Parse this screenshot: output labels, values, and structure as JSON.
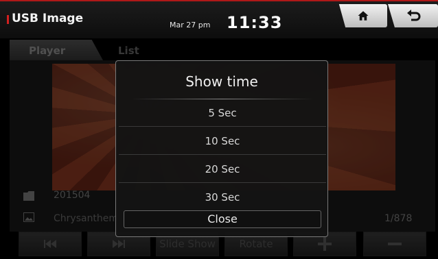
{
  "header": {
    "title": "USB Image",
    "date": "Mar 27 pm",
    "time": "11:33",
    "home_icon": "home-icon",
    "back_icon": "back-arrow-icon"
  },
  "tabs": [
    {
      "label": "Player"
    },
    {
      "label": "List"
    }
  ],
  "player": {
    "folder_name": "201504",
    "file_name": "Chrysanthem",
    "counter": "1/878"
  },
  "toolbar": {
    "prev_icon": "skip-previous-icon",
    "next_icon": "skip-next-icon",
    "slideshow_label": "Slide Show",
    "rotate_label": "Rotate",
    "zoom_in_icon": "plus-icon",
    "zoom_out_icon": "minus-icon"
  },
  "dialog": {
    "title": "Show time",
    "options": [
      {
        "label": "5 Sec"
      },
      {
        "label": "10 Sec"
      },
      {
        "label": "20 Sec"
      },
      {
        "label": "30 Sec"
      }
    ],
    "close_label": "Close"
  },
  "colors": {
    "accent": "#b01818",
    "dialog_bg": "#141414",
    "dialog_border": "#7a7a7a"
  }
}
